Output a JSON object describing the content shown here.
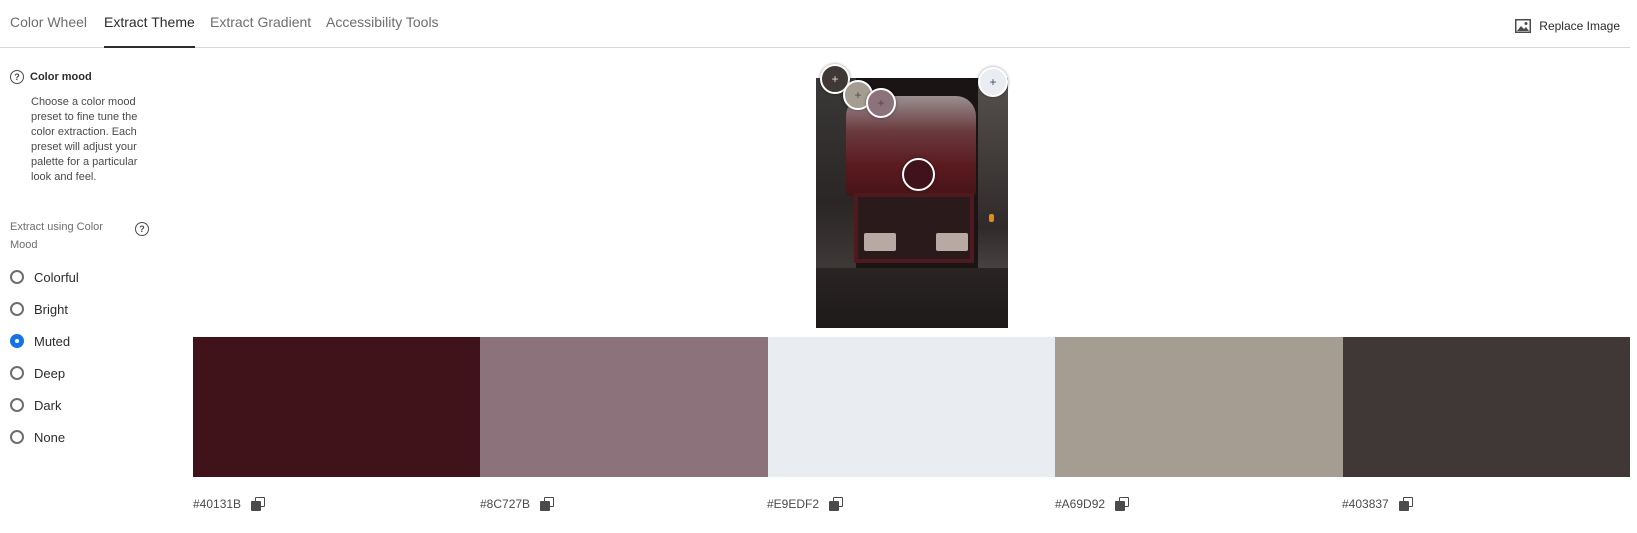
{
  "tabs": [
    {
      "label": "Color Wheel",
      "active": false
    },
    {
      "label": "Extract Theme",
      "active": true
    },
    {
      "label": "Extract Gradient",
      "active": false
    },
    {
      "label": "Accessibility Tools",
      "active": false
    }
  ],
  "replace_image": {
    "label": "Replace Image",
    "icon": "image-icon"
  },
  "sidebar": {
    "mood_title": "Color mood",
    "mood_description": "Choose a color mood preset to fine tune the color extraction. Each preset will adjust your palette for a particular look and feel.",
    "extract_label": "Extract using Color Mood",
    "options": [
      {
        "label": "Colorful",
        "checked": false
      },
      {
        "label": "Bright",
        "checked": false
      },
      {
        "label": "Muted",
        "checked": true
      },
      {
        "label": "Deep",
        "checked": false
      },
      {
        "label": "Dark",
        "checked": false
      },
      {
        "label": "None",
        "checked": false
      }
    ]
  },
  "palette": [
    {
      "hex": "#40131B",
      "color": "#40131B"
    },
    {
      "hex": "#8C727B",
      "color": "#8C727B"
    },
    {
      "hex": "#E9EDF2",
      "color": "#E9EDF2"
    },
    {
      "hex": "#A69D92",
      "color": "#A69D92"
    },
    {
      "hex": "#403837",
      "color": "#403837"
    }
  ],
  "markers": [
    {
      "color": "#403837",
      "symbol": "+"
    },
    {
      "color": "#A69D92",
      "symbol": "+"
    },
    {
      "color": "#8C727B",
      "symbol": "+"
    },
    {
      "color": "#E9EDF2",
      "symbol": "+"
    },
    {
      "color": "#40131B",
      "symbol": ""
    }
  ],
  "colors": {
    "accent": "#1473E6",
    "text": "#2C2C2C",
    "muted_text": "#6E6E6E"
  }
}
